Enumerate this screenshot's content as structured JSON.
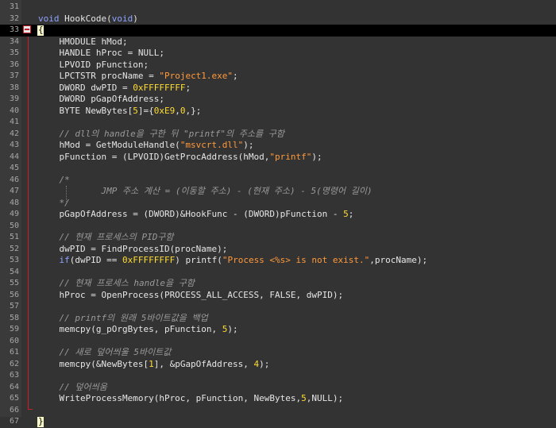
{
  "editor": {
    "fold_marker_icon": "minus-box-icon",
    "lines": [
      {
        "n": "31",
        "segs": []
      },
      {
        "n": "32",
        "segs": [
          {
            "t": "void",
            "c": "kw"
          },
          {
            "t": " HookCode("
          },
          {
            "t": "void",
            "c": "kw"
          },
          {
            "t": ")"
          }
        ]
      },
      {
        "n": "33",
        "current": true,
        "segs": [
          {
            "t": "{",
            "c": "brace"
          }
        ]
      },
      {
        "n": "34",
        "segs": [
          {
            "t": "    HMODULE hMod;"
          }
        ]
      },
      {
        "n": "35",
        "segs": [
          {
            "t": "    HANDLE hProc = NULL;"
          }
        ]
      },
      {
        "n": "36",
        "segs": [
          {
            "t": "    LPVOID pFunction;"
          }
        ]
      },
      {
        "n": "37",
        "segs": [
          {
            "t": "    LPCTSTR procName = "
          },
          {
            "t": "\"Project1.exe\"",
            "c": "str"
          },
          {
            "t": ";"
          }
        ]
      },
      {
        "n": "38",
        "segs": [
          {
            "t": "    DWORD dwPID = "
          },
          {
            "t": "0xFFFFFFFF",
            "c": "num"
          },
          {
            "t": ";"
          }
        ]
      },
      {
        "n": "39",
        "segs": [
          {
            "t": "    DWORD pGapOfAddress;"
          }
        ]
      },
      {
        "n": "40",
        "segs": [
          {
            "t": "    BYTE NewBytes["
          },
          {
            "t": "5",
            "c": "num"
          },
          {
            "t": "]={"
          },
          {
            "t": "0xE9",
            "c": "num"
          },
          {
            "t": ","
          },
          {
            "t": "0",
            "c": "num"
          },
          {
            "t": ",};"
          }
        ]
      },
      {
        "n": "41",
        "segs": []
      },
      {
        "n": "42",
        "segs": [
          {
            "t": "    // dll의 handle을 구한 뒤 \"printf\"의 주소를 구함",
            "c": "cm"
          }
        ]
      },
      {
        "n": "43",
        "segs": [
          {
            "t": "    hMod = GetModuleHandle("
          },
          {
            "t": "\"msvcrt.dll\"",
            "c": "str"
          },
          {
            "t": ");"
          }
        ]
      },
      {
        "n": "44",
        "segs": [
          {
            "t": "    pFunction = (LPVOID)GetProcAddress(hMod,"
          },
          {
            "t": "\"printf\"",
            "c": "str"
          },
          {
            "t": ");"
          }
        ]
      },
      {
        "n": "45",
        "segs": []
      },
      {
        "n": "46",
        "segs": [
          {
            "t": "    /*",
            "c": "cm"
          }
        ]
      },
      {
        "n": "47",
        "segs": [
          {
            "t": "            JMP 주소 계산 = (이동할 주소) - (현재 주소) - 5(명령어 길이)",
            "c": "cm"
          }
        ]
      },
      {
        "n": "48",
        "segs": [
          {
            "t": "    */",
            "c": "cm"
          }
        ]
      },
      {
        "n": "49",
        "segs": [
          {
            "t": "    pGapOfAddress = (DWORD)&HookFunc - (DWORD)pFunction - "
          },
          {
            "t": "5",
            "c": "num"
          },
          {
            "t": ";"
          }
        ]
      },
      {
        "n": "50",
        "segs": []
      },
      {
        "n": "51",
        "segs": [
          {
            "t": "    // 현재 프로세스의 PID구함",
            "c": "cm"
          }
        ]
      },
      {
        "n": "52",
        "segs": [
          {
            "t": "    dwPID = FindProcessID(procName);"
          }
        ]
      },
      {
        "n": "53",
        "segs": [
          {
            "t": "    "
          },
          {
            "t": "if",
            "c": "kw"
          },
          {
            "t": "(dwPID == "
          },
          {
            "t": "0xFFFFFFFF",
            "c": "num"
          },
          {
            "t": ") printf("
          },
          {
            "t": "\"Process <%s> is not exist.\"",
            "c": "str"
          },
          {
            "t": ",procName);"
          }
        ]
      },
      {
        "n": "54",
        "segs": []
      },
      {
        "n": "55",
        "segs": [
          {
            "t": "    // 현재 프로세스 handle을 구함",
            "c": "cm"
          }
        ]
      },
      {
        "n": "56",
        "segs": [
          {
            "t": "    hProc = OpenProcess(PROCESS_ALL_ACCESS, FALSE, dwPID);"
          }
        ]
      },
      {
        "n": "57",
        "segs": []
      },
      {
        "n": "58",
        "segs": [
          {
            "t": "    // printf의 원래 5바이트값을 백업",
            "c": "cm"
          }
        ]
      },
      {
        "n": "59",
        "segs": [
          {
            "t": "    memcpy(g_pOrgBytes, pFunction, "
          },
          {
            "t": "5",
            "c": "num"
          },
          {
            "t": ");"
          }
        ]
      },
      {
        "n": "60",
        "segs": []
      },
      {
        "n": "61",
        "segs": [
          {
            "t": "    // 새로 덮어씌울 5바이트값",
            "c": "cm"
          }
        ]
      },
      {
        "n": "62",
        "segs": [
          {
            "t": "    memcpy(&NewBytes["
          },
          {
            "t": "1",
            "c": "num"
          },
          {
            "t": "], &pGapOfAddress, "
          },
          {
            "t": "4",
            "c": "num"
          },
          {
            "t": ");"
          }
        ]
      },
      {
        "n": "63",
        "segs": []
      },
      {
        "n": "64",
        "segs": [
          {
            "t": "    // 덮어씌움",
            "c": "cm"
          }
        ]
      },
      {
        "n": "65",
        "segs": [
          {
            "t": "    WriteProcessMemory(hProc, pFunction, NewBytes,"
          },
          {
            "t": "5",
            "c": "num"
          },
          {
            "t": ",NULL);"
          }
        ]
      },
      {
        "n": "66",
        "segs": []
      },
      {
        "n": "67",
        "segs": [
          {
            "t": "}",
            "c": "brace"
          }
        ]
      }
    ]
  }
}
